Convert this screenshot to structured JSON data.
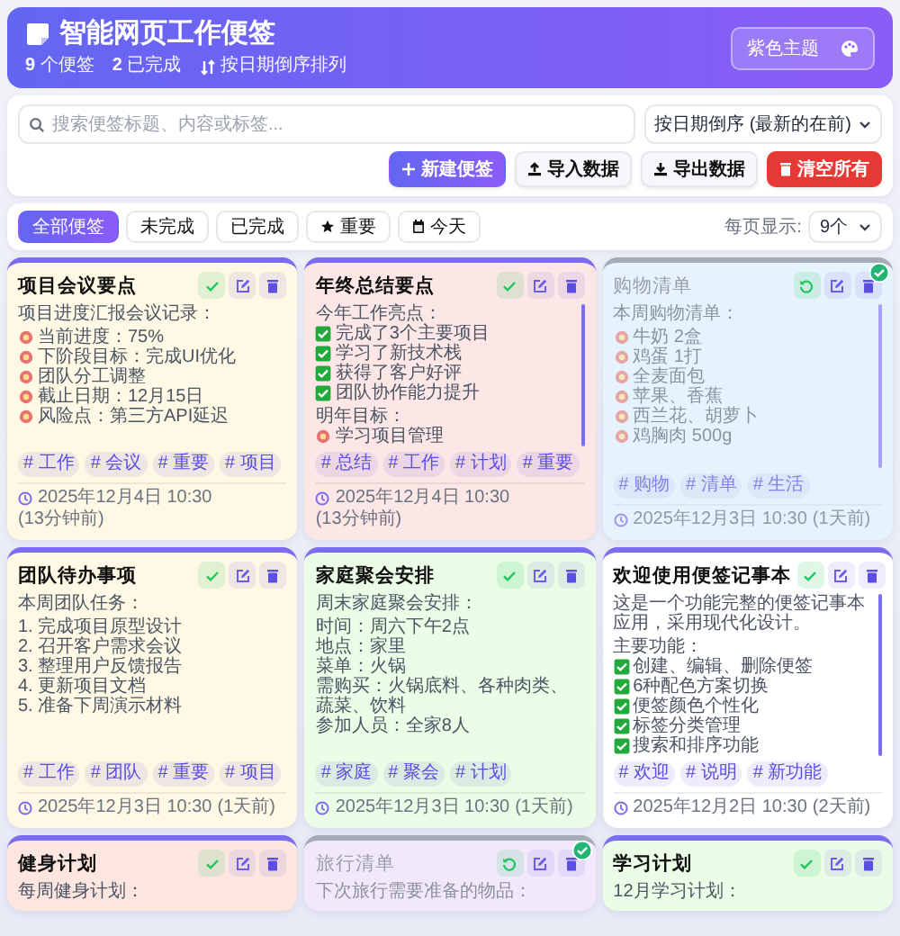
{
  "header": {
    "title": "智能网页工作便签",
    "stats": [
      {
        "kind": "count",
        "text": "**9** 个便签"
      },
      {
        "kind": "count",
        "text": "**2** 已完成"
      },
      {
        "kind": "sort",
        "text": "按日期倒序排列"
      }
    ],
    "theme_button": "紫色主题"
  },
  "toolbar": {
    "search": {
      "placeholder": "搜索便签标题、内容或标签..."
    },
    "sort_select": "按日期倒序 (最新的在前)",
    "buttons": [
      {
        "kind": "new",
        "label": "新建便签"
      },
      {
        "kind": "import",
        "label": "导入数据"
      },
      {
        "kind": "export",
        "label": "导出数据"
      },
      {
        "kind": "clear",
        "label": "清空所有"
      }
    ]
  },
  "filters": {
    "tabs": [
      {
        "kind": "plain",
        "label": "全部便签",
        "selected": true
      },
      {
        "kind": "plain",
        "label": "未完成",
        "selected": false
      },
      {
        "kind": "plain",
        "label": "已完成",
        "selected": false
      },
      {
        "kind": "star",
        "label": "重要",
        "selected": false
      },
      {
        "kind": "calendar",
        "label": "今天",
        "selected": false
      }
    ],
    "per_page_label": "每页显示:",
    "per_page": "9个"
  },
  "notes": [
    {
      "title": "项目会议要点",
      "completed": false,
      "color": "#fef8e4",
      "content": [
        [
          {
            "kind": "text",
            "text": "项目进度汇报会议记录："
          }
        ],
        [
          {
            "kind": "icon",
            "text": "当前进度：75%"
          },
          {
            "kind": "icon",
            "text": "下阶段目标：完成UI优化"
          },
          {
            "kind": "icon",
            "text": "团队分工调整"
          },
          {
            "kind": "icon",
            "text": "截止日期：12月15日"
          },
          {
            "kind": "icon",
            "text": "风险点：第三方API延迟"
          }
        ]
      ],
      "tags": [
        "# 工作",
        "# 会议",
        "# 重要",
        "# 项目"
      ],
      "time": "2025年12月4日 10:30",
      "ago": "(13分钟前)"
    },
    {
      "title": "年终总结要点",
      "completed": false,
      "color": "#fde6e6",
      "content": [
        [
          {
            "kind": "text",
            "text": "今年工作亮点："
          },
          {
            "kind": "check",
            "text": "完成了3个主要项目"
          },
          {
            "kind": "check",
            "text": "学习了新技术栈"
          },
          {
            "kind": "check",
            "text": "获得了客户好评"
          },
          {
            "kind": "check",
            "text": "团队协作能力提升"
          }
        ],
        [
          {
            "kind": "text",
            "text": "明年目标："
          },
          {
            "kind": "icon",
            "text": "学习项目管理"
          }
        ]
      ],
      "tags": [
        "# 总结",
        "# 工作",
        "# 计划",
        "# 重要"
      ],
      "time": "2025年12月4日 10:30",
      "ago": "(13分钟前)"
    },
    {
      "title": "购物清单",
      "completed": true,
      "color": "#e6f3fc",
      "content": [
        [
          {
            "kind": "text",
            "text": "本周购物清单："
          }
        ],
        [
          {
            "kind": "icon",
            "text": "牛奶 2盒"
          },
          {
            "kind": "icon",
            "text": "鸡蛋 1打"
          },
          {
            "kind": "icon",
            "text": "全麦面包"
          },
          {
            "kind": "icon",
            "text": "苹果、香蕉"
          },
          {
            "kind": "icon",
            "text": "西兰花、胡萝卜"
          },
          {
            "kind": "icon",
            "text": "鸡胸肉 500g"
          }
        ]
      ],
      "tags": [
        "# 购物",
        "# 清单",
        "# 生活"
      ],
      "time": "2025年12月3日 10:30",
      "ago": "(1天前)"
    },
    {
      "title": "团队待办事项",
      "completed": false,
      "color": "#fef8e4",
      "content": [
        [
          {
            "kind": "text",
            "text": "本周团队任务："
          }
        ],
        [
          {
            "kind": "text",
            "text": "1. 完成项目原型设计"
          },
          {
            "kind": "text",
            "text": "2. 召开客户需求会议"
          },
          {
            "kind": "text",
            "text": "3. 整理用户反馈报告"
          },
          {
            "kind": "text",
            "text": "4. 更新项目文档"
          },
          {
            "kind": "text",
            "text": "5. 准备下周演示材料"
          }
        ]
      ],
      "tags": [
        "# 工作",
        "# 团队",
        "# 重要",
        "# 项目"
      ],
      "time": "2025年12月3日 10:30",
      "ago": "(1天前)"
    },
    {
      "title": "家庭聚会安排",
      "completed": false,
      "color": "#ebfde6",
      "content": [
        [
          {
            "kind": "text",
            "text": "周末家庭聚会安排："
          }
        ],
        [
          {
            "kind": "text",
            "text": "时间：周六下午2点"
          },
          {
            "kind": "text",
            "text": "地点：家里"
          },
          {
            "kind": "text",
            "text": "菜单：火锅"
          },
          {
            "kind": "text",
            "text": "需购买：火锅底料、各种肉类、蔬菜、饮料"
          },
          {
            "kind": "text",
            "text": "参加人员：全家8人"
          }
        ]
      ],
      "tags": [
        "# 家庭",
        "# 聚会",
        "# 计划"
      ],
      "time": "2025年12月3日 10:30",
      "ago": "(1天前)"
    },
    {
      "title": "欢迎使用便签记事本",
      "completed": false,
      "color": "#ffffff",
      "content": [
        [
          {
            "kind": "text",
            "text": "这是一个功能完整的便签记事本应用，采用现代化设计。"
          }
        ],
        [
          {
            "kind": "text",
            "text": "主要功能："
          },
          {
            "kind": "check",
            "text": "创建、编辑、删除便签"
          },
          {
            "kind": "check",
            "text": "6种配色方案切换"
          },
          {
            "kind": "check",
            "text": "便签颜色个性化"
          },
          {
            "kind": "check",
            "text": "标签分类管理"
          },
          {
            "kind": "check",
            "text": "搜索和排序功能"
          }
        ]
      ],
      "tags": [
        "# 欢迎",
        "# 说明",
        "# 新功能"
      ],
      "time": "2025年12月2日 10:30",
      "ago": "(2天前)"
    },
    {
      "title": "健身计划",
      "completed": false,
      "color": "#fde6e0",
      "content": [
        [
          {
            "kind": "text",
            "text": "每周健身计划："
          }
        ]
      ]
    },
    {
      "title": "旅行清单",
      "completed": true,
      "color": "#f1e8fc",
      "content": [
        [
          {
            "kind": "text",
            "text": "下次旅行需要准备的物品："
          }
        ]
      ]
    },
    {
      "title": "学习计划",
      "completed": false,
      "color": "#ebfde6",
      "content": [
        [
          {
            "kind": "text",
            "text": "12月学习计划："
          }
        ]
      ]
    }
  ]
}
